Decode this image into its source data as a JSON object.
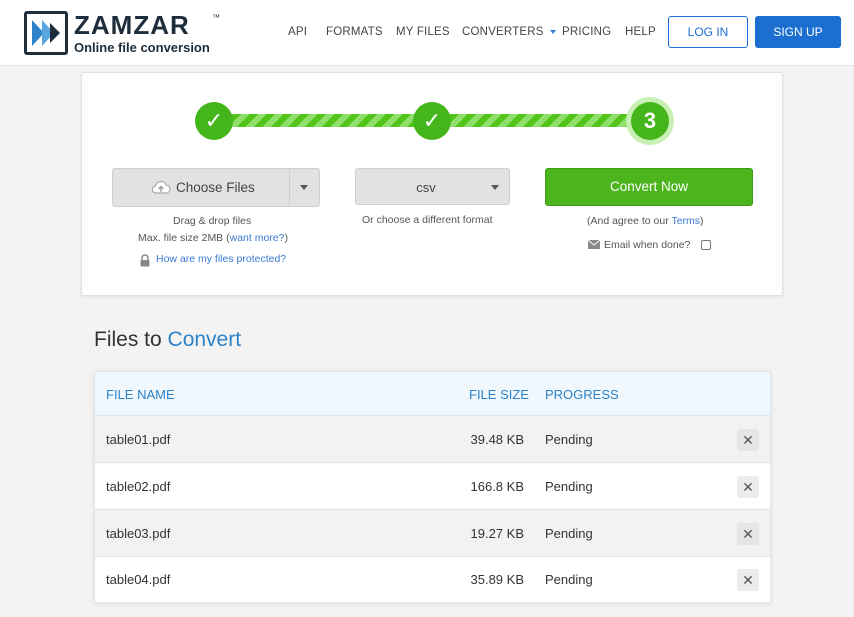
{
  "brand": {
    "name": "ZAMZAR",
    "trademark": "™",
    "tagline": "Online file conversion",
    "colors": {
      "navy": "#1e2d3b",
      "blue": "#1c6fd0",
      "green": "#4cb51d",
      "accent": "#2d82c8"
    }
  },
  "nav": {
    "items": [
      {
        "label": "API"
      },
      {
        "label": "FORMATS"
      },
      {
        "label": "MY FILES"
      },
      {
        "label": "CONVERTERS",
        "dropdown": true
      },
      {
        "label": "PRICING"
      },
      {
        "label": "HELP"
      }
    ],
    "login_label": "LOG IN",
    "signup_label": "SIGN UP"
  },
  "steps": [
    {
      "state": "done",
      "glyph": "✓"
    },
    {
      "state": "done",
      "glyph": "✓"
    },
    {
      "state": "current",
      "glyph": "3"
    }
  ],
  "upload": {
    "choose_label": "Choose Files",
    "drag_text": "Drag & drop files",
    "max_size_text": "Max. file size 2MB",
    "want_more_link": "want more?",
    "protected_link": "How are my files protected?"
  },
  "format": {
    "selected": "csv",
    "hint": "Or choose a different format"
  },
  "convert": {
    "button_label": "Convert Now",
    "agree_text": "(And agree to our",
    "terms_link": "Terms",
    "agree_close": ")",
    "email_label": "Email when done?",
    "email_checked": false
  },
  "files_section": {
    "title_plain": "Files to",
    "title_accent": "Convert",
    "columns": {
      "name": "FILE NAME",
      "size": "FILE SIZE",
      "progress": "PROGRESS"
    },
    "rows": [
      {
        "name": "table01.pdf",
        "size": "39.48 KB",
        "progress": "Pending"
      },
      {
        "name": "table02.pdf",
        "size": "166.8 KB",
        "progress": "Pending"
      },
      {
        "name": "table03.pdf",
        "size": "19.27 KB",
        "progress": "Pending"
      },
      {
        "name": "table04.pdf",
        "size": "35.89 KB",
        "progress": "Pending"
      }
    ],
    "remove_glyph": "✕"
  }
}
